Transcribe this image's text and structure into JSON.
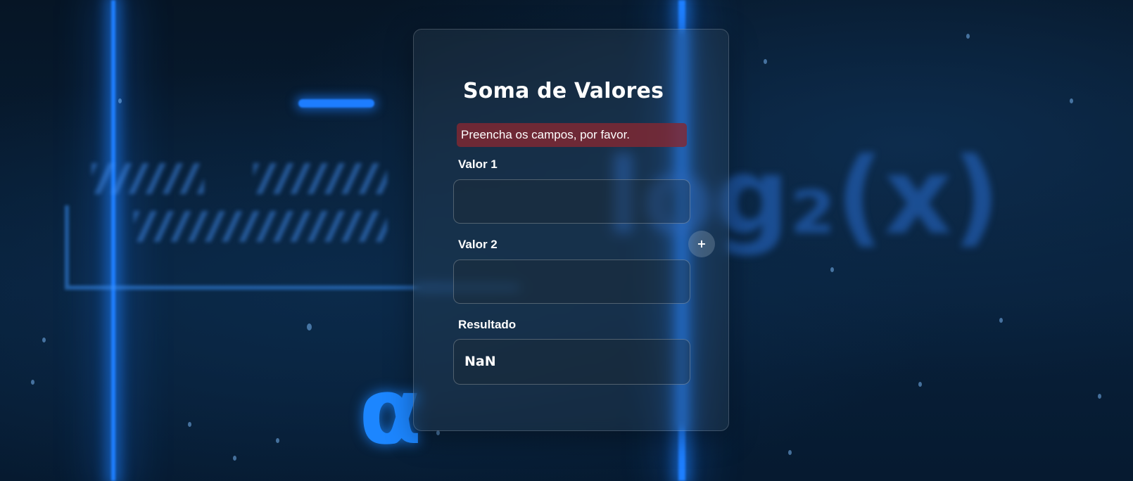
{
  "card": {
    "title": "Soma de Valores",
    "alert": "Preencha os campos, por favor.",
    "field1_label": "Valor 1",
    "field1_value": "",
    "field2_label": "Valor 2",
    "field2_value": "",
    "result_label": "Resultado",
    "result_value": "NaN",
    "add_button_icon": "plus-icon",
    "add_button_glyph": "+"
  },
  "background": {
    "glyph_alpha": "α",
    "glyph_log": "log₂(x)"
  },
  "colors": {
    "alert_bg": "#822832",
    "accent_beam": "#1e7fff",
    "text": "#ffffff"
  }
}
